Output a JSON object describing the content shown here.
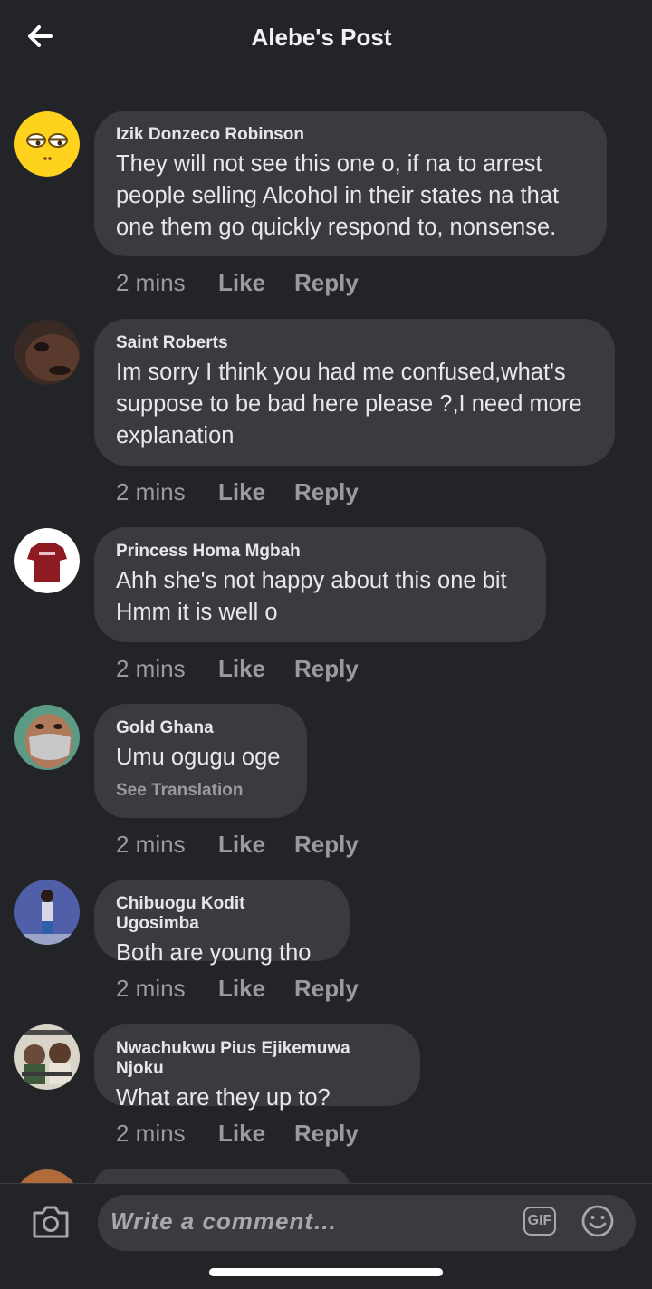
{
  "header": {
    "title": "Alebe's Post",
    "back_icon": "arrow-left-icon"
  },
  "comments": [
    {
      "author": "Izik Donzeco Robinson",
      "text": "They will not see this one o, if na to arrest people selling Alcohol in their states na that one them go quickly respond to, nonsense.",
      "time": "2 mins",
      "like": "Like",
      "reply": "Reply"
    },
    {
      "author": "Saint Roberts",
      "text": "Im sorry I think you had me confused,what's suppose to be bad here please ?,I need more explanation",
      "time": "2 mins",
      "like": "Like",
      "reply": "Reply"
    },
    {
      "author": "Princess Homa Mgbah",
      "text": "Ahh she's not happy about this one bit Hmm it is well o",
      "time": "2 mins",
      "like": "Like",
      "reply": "Reply"
    },
    {
      "author": "Gold Ghana",
      "text": "Umu ogugu oge",
      "translation": "See Translation",
      "time": "2 mins",
      "like": "Like",
      "reply": "Reply"
    },
    {
      "author": "Chibuogu Kodit Ugosimba",
      "text": "Both are young tho",
      "time": "2 mins",
      "like": "Like",
      "reply": "Reply"
    },
    {
      "author": "Nwachukwu Pius Ejikemuwa Njoku",
      "text": "What are they up to?",
      "time": "2 mins",
      "like": "Like",
      "reply": "Reply"
    }
  ],
  "composer": {
    "placeholder": "Write a comment…",
    "gif_label": "GIF",
    "camera_icon": "camera-icon",
    "emoji_icon": "smiley-icon"
  },
  "colors": {
    "background": "#232427",
    "bubble": "#3a3b3e",
    "muted": "#9a9ba0"
  }
}
